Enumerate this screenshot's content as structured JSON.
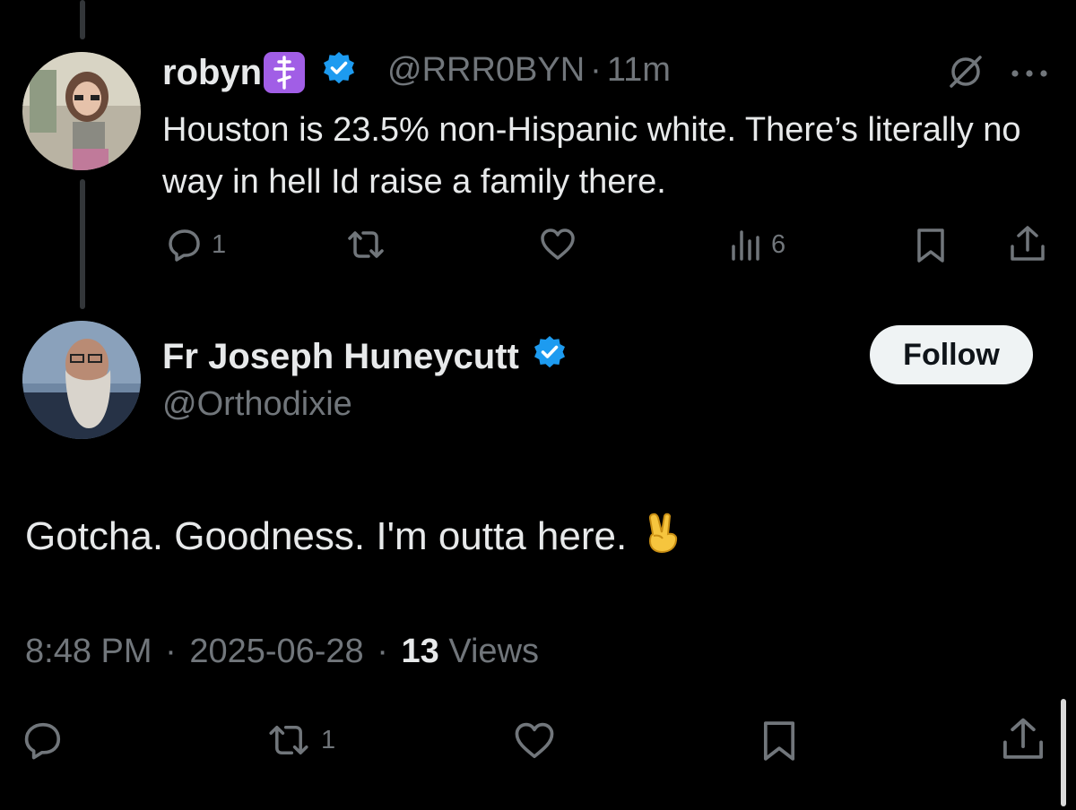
{
  "parent_tweet": {
    "name": "robyn",
    "name_badge": "☦",
    "handle": "@RRR0BYN",
    "separator": "·",
    "time": "11m",
    "text": "Houston is 23.5% non-Hispanic white. There’s literally no way in hell Id raise a family there.",
    "actions": {
      "replies": "1",
      "retweets": "",
      "likes": "",
      "views": "6"
    }
  },
  "main_tweet": {
    "name": "Fr Joseph Huneycutt",
    "handle": "@Orthodixie",
    "follow_label": "Follow",
    "text": "Gotcha. Goodness. I'm outta here.",
    "emoji": "✌️",
    "meta": {
      "time": "8:48 PM",
      "date": "2025-06-28",
      "separator": "·",
      "views_count": "13",
      "views_label": "Views"
    },
    "actions": {
      "replies": "",
      "retweets": "1",
      "likes": ""
    }
  },
  "icons": {
    "verified": "verified-badge-icon",
    "grok": "grok-icon",
    "more": "more-icon",
    "reply": "reply-icon",
    "retweet": "retweet-icon",
    "like": "like-icon",
    "views": "views-icon",
    "bookmark": "bookmark-icon",
    "share": "share-icon"
  },
  "colors": {
    "background": "#000000",
    "text": "#e7e9ea",
    "muted": "#71767b",
    "verified": "#1d9bf0",
    "badge": "#a15ee6",
    "thread_line": "#333639"
  }
}
